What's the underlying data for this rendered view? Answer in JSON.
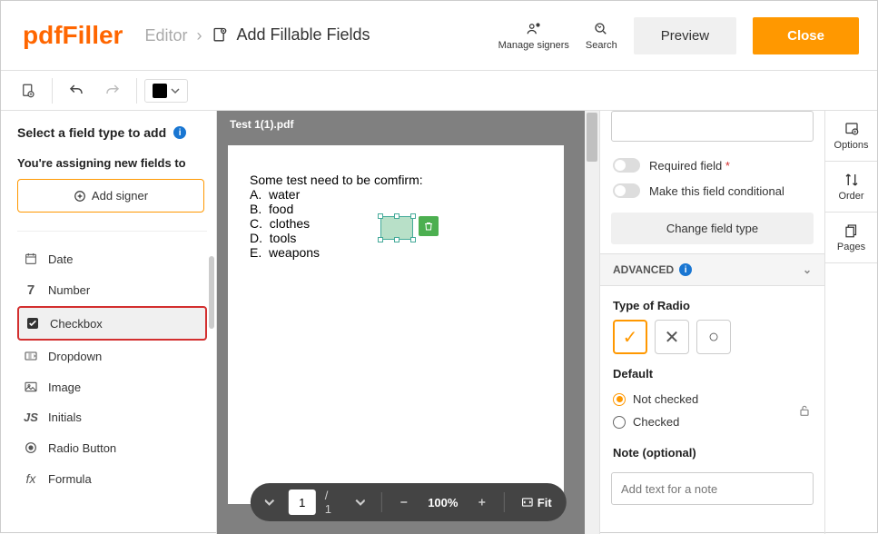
{
  "logo": {
    "part1": "pdf",
    "part2": "Filler"
  },
  "breadcrumb": {
    "prev": "Editor",
    "current": "Add Fillable Fields"
  },
  "header_actions": {
    "manage_signers": "Manage signers",
    "search": "Search",
    "preview": "Preview",
    "close": "Close"
  },
  "left_panel": {
    "title": "Select a field type to add",
    "assign_label": "You're assigning new fields to",
    "add_signer": "Add signer",
    "fields": [
      {
        "icon": "date",
        "label": "Date"
      },
      {
        "icon": "number",
        "label": "Number"
      },
      {
        "icon": "checkbox",
        "label": "Checkbox",
        "active": true
      },
      {
        "icon": "dropdown",
        "label": "Dropdown"
      },
      {
        "icon": "image",
        "label": "Image"
      },
      {
        "icon": "initials",
        "label": "Initials"
      },
      {
        "icon": "radio",
        "label": "Radio Button"
      },
      {
        "icon": "formula",
        "label": "Formula"
      }
    ]
  },
  "document": {
    "filename": "Test 1(1).pdf",
    "lines": [
      "Some test need to be comfirm:",
      "A.  water",
      "B.  food",
      "C.  clothes",
      "D.  tools",
      "E.  weapons"
    ]
  },
  "page_nav": {
    "current": "1",
    "total": "/ 1",
    "zoom": "100%",
    "fit": "Fit"
  },
  "right_panel": {
    "required_label": "Required field",
    "conditional_label": "Make this field conditional",
    "change_type": "Change field type",
    "advanced": "ADVANCED",
    "type_of_radio": "Type of Radio",
    "default": "Default",
    "not_checked": "Not checked",
    "checked": "Checked",
    "note_label": "Note (optional)",
    "note_placeholder": "Add text for a note"
  },
  "rail": {
    "options": "Options",
    "order": "Order",
    "pages": "Pages"
  }
}
